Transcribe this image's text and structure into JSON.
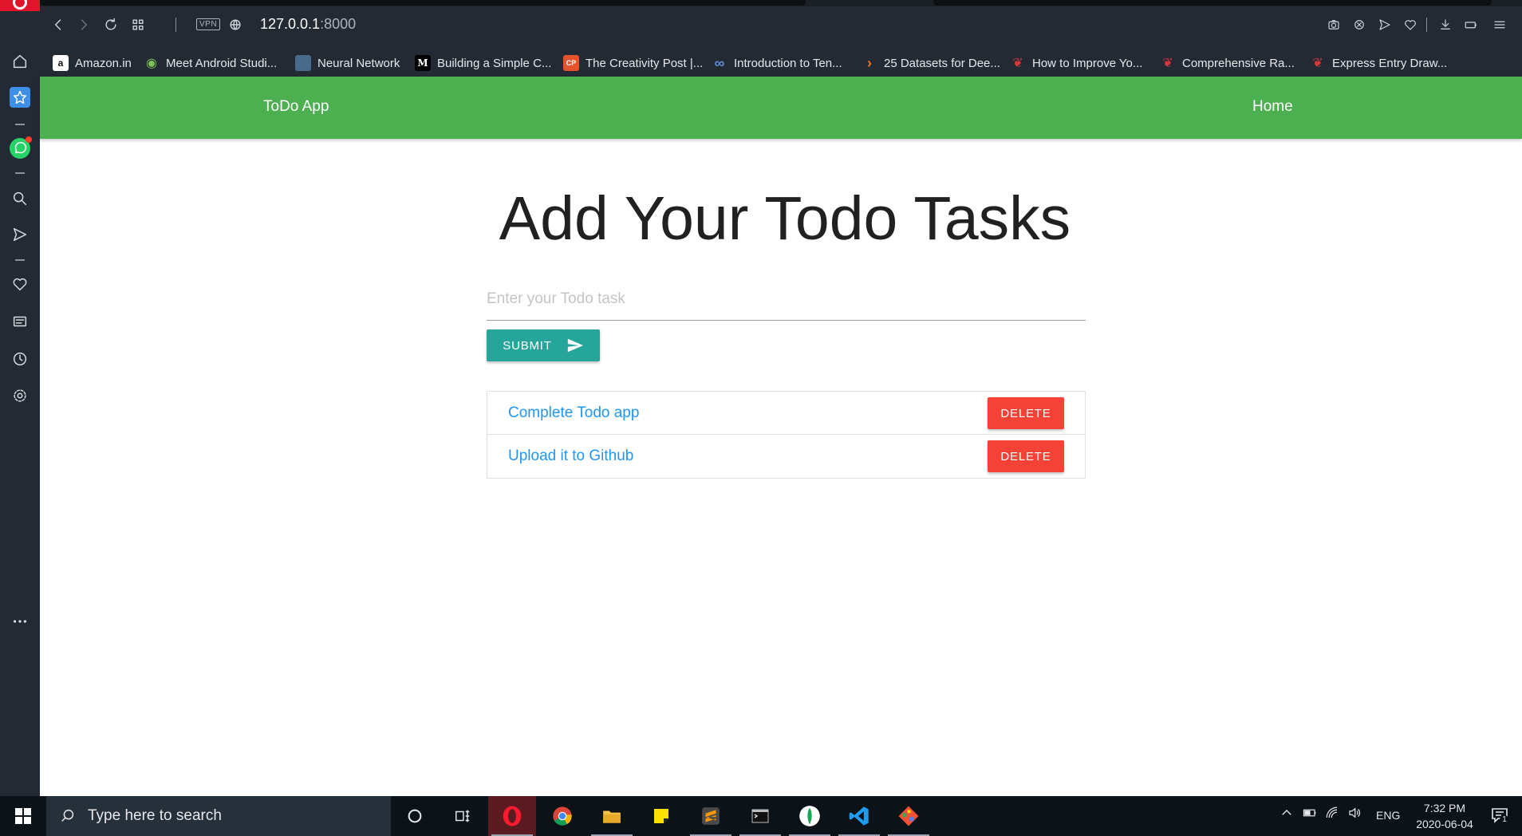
{
  "browser": {
    "url_host": "127.0.0.1",
    "url_port": ":8000",
    "vpn_label": "VPN",
    "bookmarks": [
      {
        "label": "Amazon.in",
        "icon": "a",
        "color": "#ffffff"
      },
      {
        "label": "Meet Android Studi...",
        "icon": "android-icon",
        "color": "#78c257"
      },
      {
        "label": "Neural Network",
        "icon": "nn-icon",
        "color": "#4a6a8a"
      },
      {
        "label": "Building a Simple C...",
        "icon": "M",
        "color": "#000000"
      },
      {
        "label": "The Creativity Post |...",
        "icon": "CP",
        "color": "#e5532d"
      },
      {
        "label": "Introduction to Ten...",
        "icon": "coursera-icon",
        "color": "#5b8dd9"
      },
      {
        "label": "25 Datasets for Dee...",
        "icon": "chevron-icon",
        "color": "#e8742b"
      },
      {
        "label": "How to Improve Yo...",
        "icon": "hand-icon",
        "color": "#d9363e"
      },
      {
        "label": "Comprehensive Ra...",
        "icon": "hand-icon",
        "color": "#d9363e"
      },
      {
        "label": "Express Entry Draw...",
        "icon": "hand-icon",
        "color": "#d9363e"
      }
    ]
  },
  "app": {
    "brand": "ToDo App",
    "nav_home": "Home",
    "heading": "Add Your Todo Tasks",
    "input_placeholder": "Enter your Todo task",
    "submit_label": "SUBMIT",
    "delete_label": "DELETE",
    "todos": [
      "Complete Todo app",
      "Upload it to Github"
    ],
    "colors": {
      "navbar": "#4caf50",
      "submit": "#26a69a",
      "delete": "#f44336",
      "todo_text": "#2196f3"
    }
  },
  "taskbar": {
    "search_placeholder": "Type here to search",
    "language": "ENG",
    "time": "7:32 PM",
    "date": "2020-06-04",
    "notification_count": "1"
  }
}
